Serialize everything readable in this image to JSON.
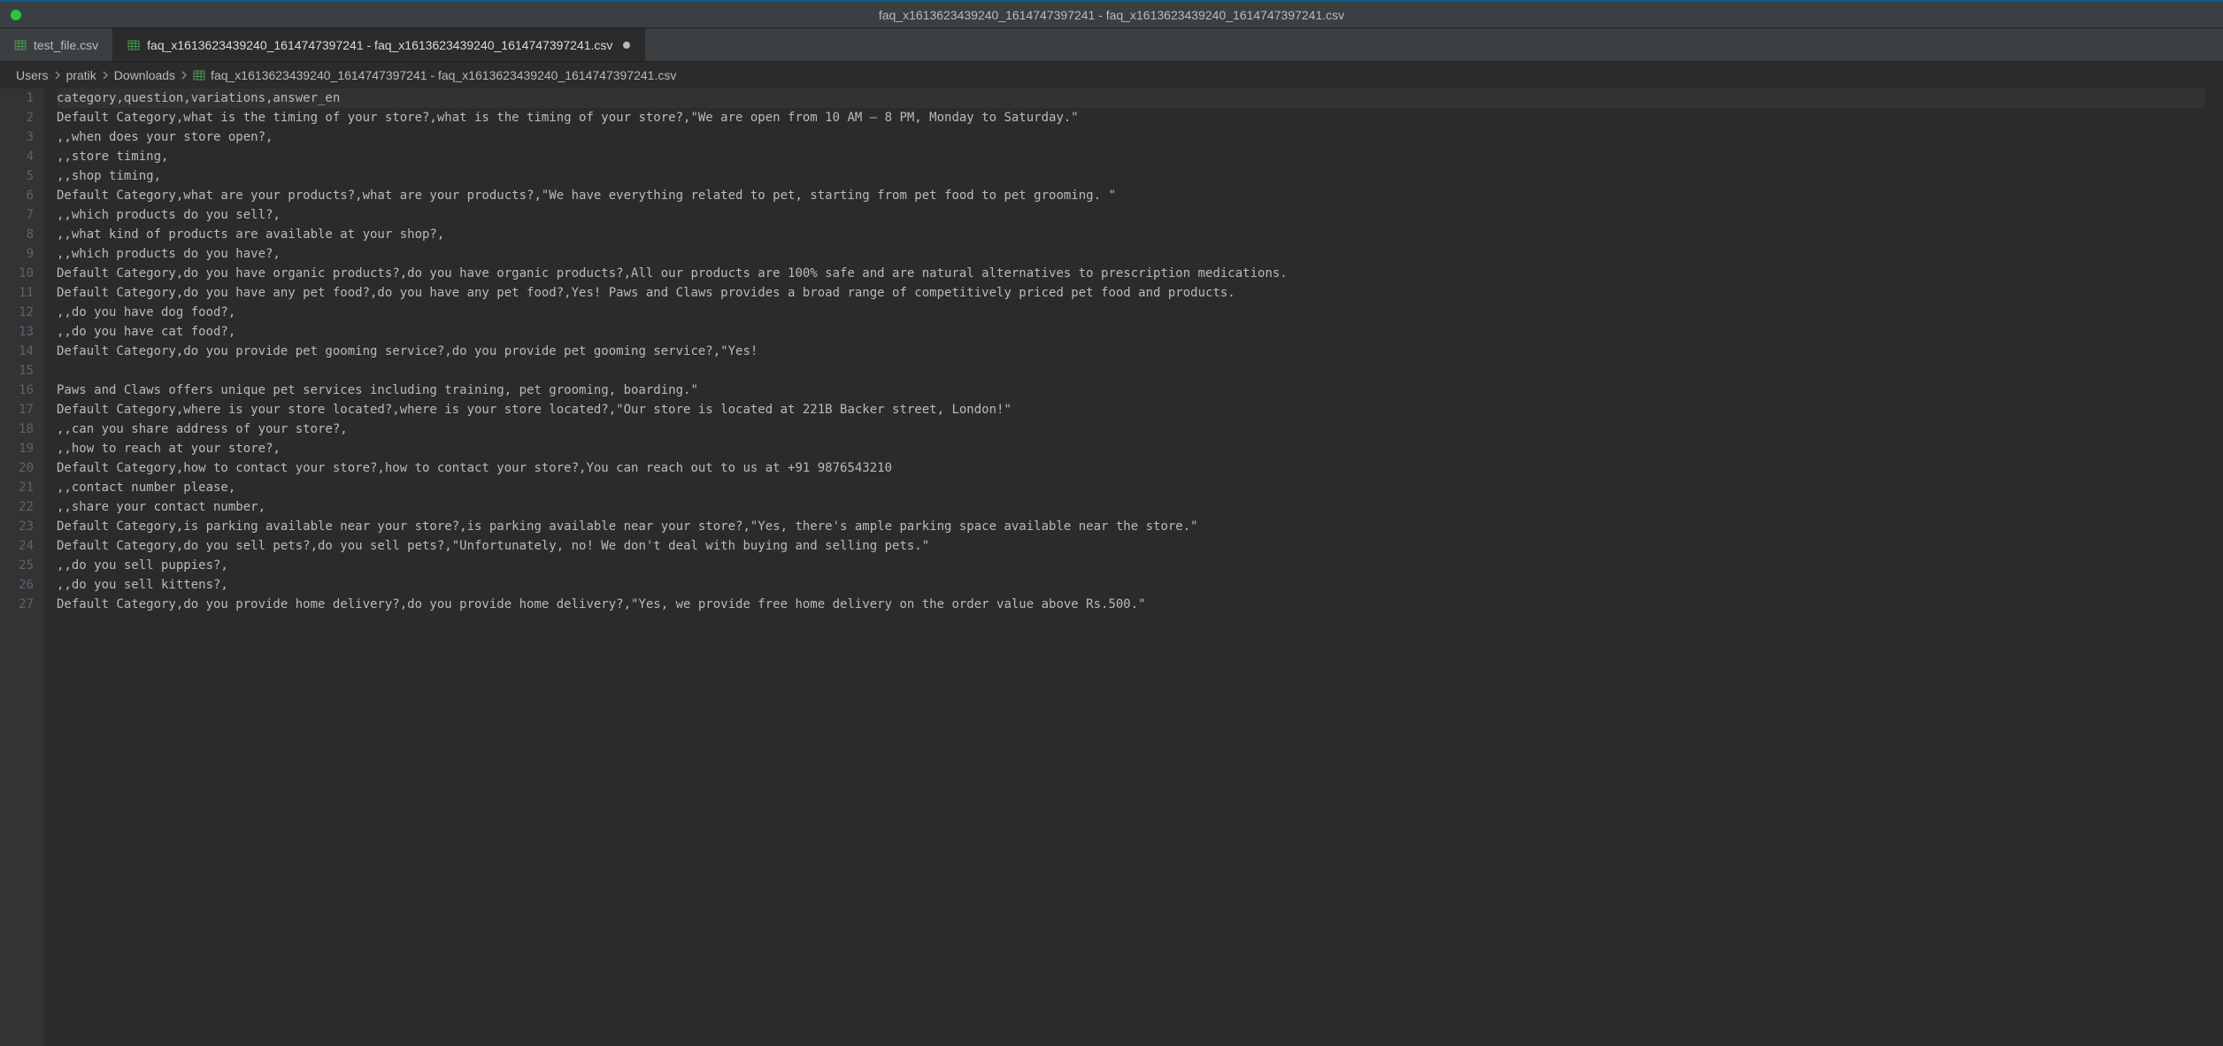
{
  "window": {
    "title": "faq_x1613623439240_1614747397241 - faq_x1613623439240_1614747397241.csv"
  },
  "tabs": [
    {
      "label": "test_file.csv",
      "active": false,
      "modified": false
    },
    {
      "label": "faq_x1613623439240_1614747397241 - faq_x1613623439240_1614747397241.csv",
      "active": true,
      "modified": true
    }
  ],
  "breadcrumbs": {
    "segments": [
      "Users",
      "pratik",
      "Downloads"
    ],
    "file": "faq_x1613623439240_1614747397241 - faq_x1613623439240_1614747397241.csv"
  },
  "editor": {
    "lines": [
      "category,question,variations,answer_en",
      "Default Category,what is the timing of your store?,what is the timing of your store?,\"We are open from 10 AM – 8 PM, Monday to Saturday.\"",
      ",,when does your store open?,",
      ",,store timing,",
      ",,shop timing,",
      "Default Category,what are your products?,what are your products?,\"We have everything related to pet, starting from pet food to pet grooming. \"",
      ",,which products do you sell?,",
      ",,what kind of products are available at your shop?,",
      ",,which products do you have?,",
      "Default Category,do you have organic products?,do you have organic products?,All our products are 100% safe and are natural alternatives to prescription medications.",
      "Default Category,do you have any pet food?,do you have any pet food?,Yes! Paws and Claws provides a broad range of competitively priced pet food and products.",
      ",,do you have dog food?,",
      ",,do you have cat food?,",
      "Default Category,do you provide pet gooming service?,do you provide pet gooming service?,\"Yes!",
      "",
      "Paws and Claws offers unique pet services including training, pet grooming, boarding.\"",
      "Default Category,where is your store located?,where is your store located?,\"Our store is located at 221B Backer street, London!\"",
      ",,can you share address of your store?,",
      ",,how to reach at your store?,",
      "Default Category,how to contact your store?,how to contact your store?,You can reach out to us at +91 9876543210",
      ",,contact number please,",
      ",,share your contact number,",
      "Default Category,is parking available near your store?,is parking available near your store?,\"Yes, there's ample parking space available near the store.\"",
      "Default Category,do you sell pets?,do you sell pets?,\"Unfortunately, no! We don't deal with buying and selling pets.\"",
      ",,do you sell puppies?,",
      ",,do you sell kittens?,",
      "Default Category,do you provide home delivery?,do you provide home delivery?,\"Yes, we provide free home delivery on the order value above Rs.500.\""
    ]
  }
}
